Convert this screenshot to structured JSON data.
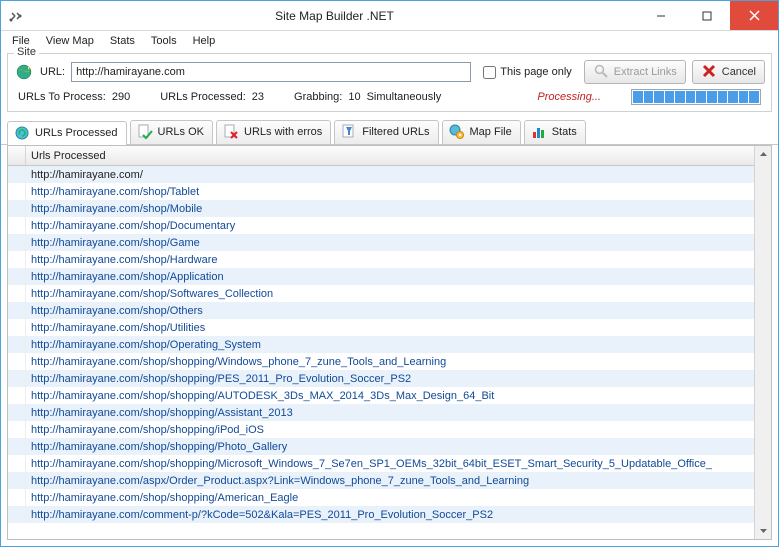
{
  "window": {
    "title": "Site Map Builder .NET"
  },
  "menu": {
    "items": [
      "File",
      "View Map",
      "Stats",
      "Tools",
      "Help"
    ]
  },
  "site": {
    "legend": "Site",
    "url_label": "URL:",
    "url_value": "http://hamirayane.com",
    "page_only_label": "This page only",
    "extract_label": "Extract Links",
    "cancel_label": "Cancel"
  },
  "status": {
    "to_process_label": "URLs To Process:",
    "to_process_val": "290",
    "processed_label": "URLs Processed:",
    "processed_val": "23",
    "grabbing_label": "Grabbing:",
    "grabbing_val": "10",
    "simul_label": "Simultaneously",
    "processing_label": "Processing..."
  },
  "tabs": [
    {
      "label": "URLs Processed"
    },
    {
      "label": "URLs OK"
    },
    {
      "label": "URLs with erros"
    },
    {
      "label": "Filtered URLs"
    },
    {
      "label": "Map File"
    },
    {
      "label": "Stats"
    }
  ],
  "grid": {
    "header": "Urls Processed",
    "rows": [
      "http://hamirayane.com/",
      "http://hamirayane.com/shop/Tablet",
      "http://hamirayane.com/shop/Mobile",
      "http://hamirayane.com/shop/Documentary",
      "http://hamirayane.com/shop/Game",
      "http://hamirayane.com/shop/Hardware",
      "http://hamirayane.com/shop/Application",
      "http://hamirayane.com/shop/Softwares_Collection",
      "http://hamirayane.com/shop/Others",
      "http://hamirayane.com/shop/Utilities",
      "http://hamirayane.com/shop/Operating_System",
      "http://hamirayane.com/shop/shopping/Windows_phone_7_zune_Tools_and_Learning",
      "http://hamirayane.com/shop/shopping/PES_2011_Pro_Evolution_Soccer_PS2",
      "http://hamirayane.com/shop/shopping/AUTODESK_3Ds_MAX_2014_3Ds_Max_Design_64_Bit",
      "http://hamirayane.com/shop/shopping/Assistant_2013",
      "http://hamirayane.com/shop/shopping/iPod_iOS",
      "http://hamirayane.com/shop/shopping/Photo_Gallery",
      "http://hamirayane.com/shop/shopping/Microsoft_Windows_7_Se7en_SP1_OEMs_32bit_64bit_ESET_Smart_Security_5_Updatable_Office_",
      "http://hamirayane.com/aspx/Order_Product.aspx?Link=Windows_phone_7_zune_Tools_and_Learning",
      "http://hamirayane.com/shop/shopping/American_Eagle",
      "http://hamirayane.com/comment-p/?kCode=502&Kala=PES_2011_Pro_Evolution_Soccer_PS2"
    ]
  }
}
